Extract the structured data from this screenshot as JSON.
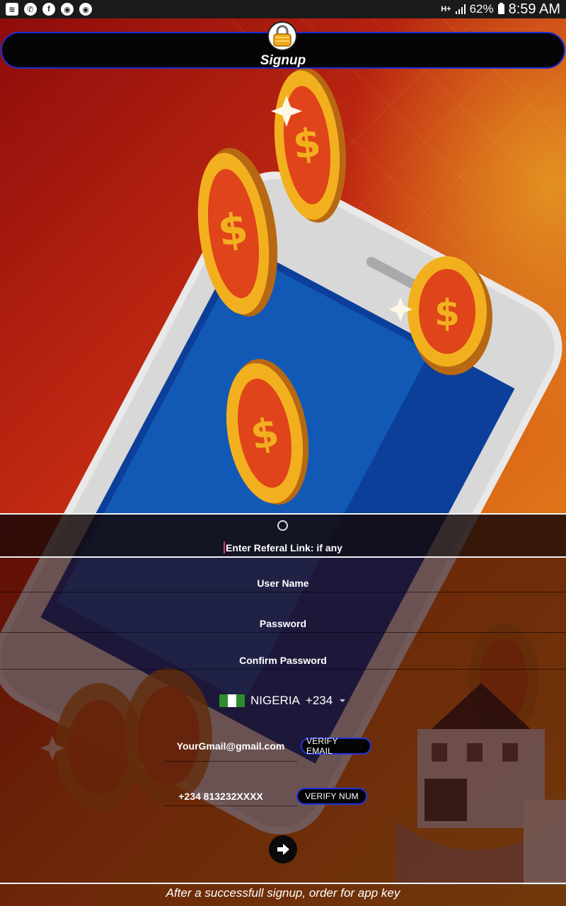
{
  "status_bar": {
    "battery": "62%",
    "time": "8:59 AM",
    "network": "H+",
    "left_icons": [
      "wifi-icon",
      "whatsapp-icon",
      "facebook-icon",
      "chrome-icon",
      "chrome-icon"
    ]
  },
  "header": {
    "title": "Signup",
    "icon": "lock-icon"
  },
  "form": {
    "referral_placeholder": "Enter Referal Link: if any",
    "username_placeholder": "User Name",
    "password_placeholder": "Password",
    "confirm_password_placeholder": "Confirm Password",
    "country": {
      "name": "NIGERIA",
      "code": "+234"
    },
    "email_placeholder": "YourGmail@gmail.com",
    "verify_email_label": "VERIFY EMAIL",
    "phone_placeholder": "+234 813232XXXX",
    "verify_num_label": "VERIFY NUM",
    "submit_icon": "arrow-right-icon"
  },
  "footer": {
    "text": "After a successfull  signup, order for  app key"
  },
  "colors": {
    "accent_border": "#1c2cd6",
    "cursor": "#e0307a"
  }
}
